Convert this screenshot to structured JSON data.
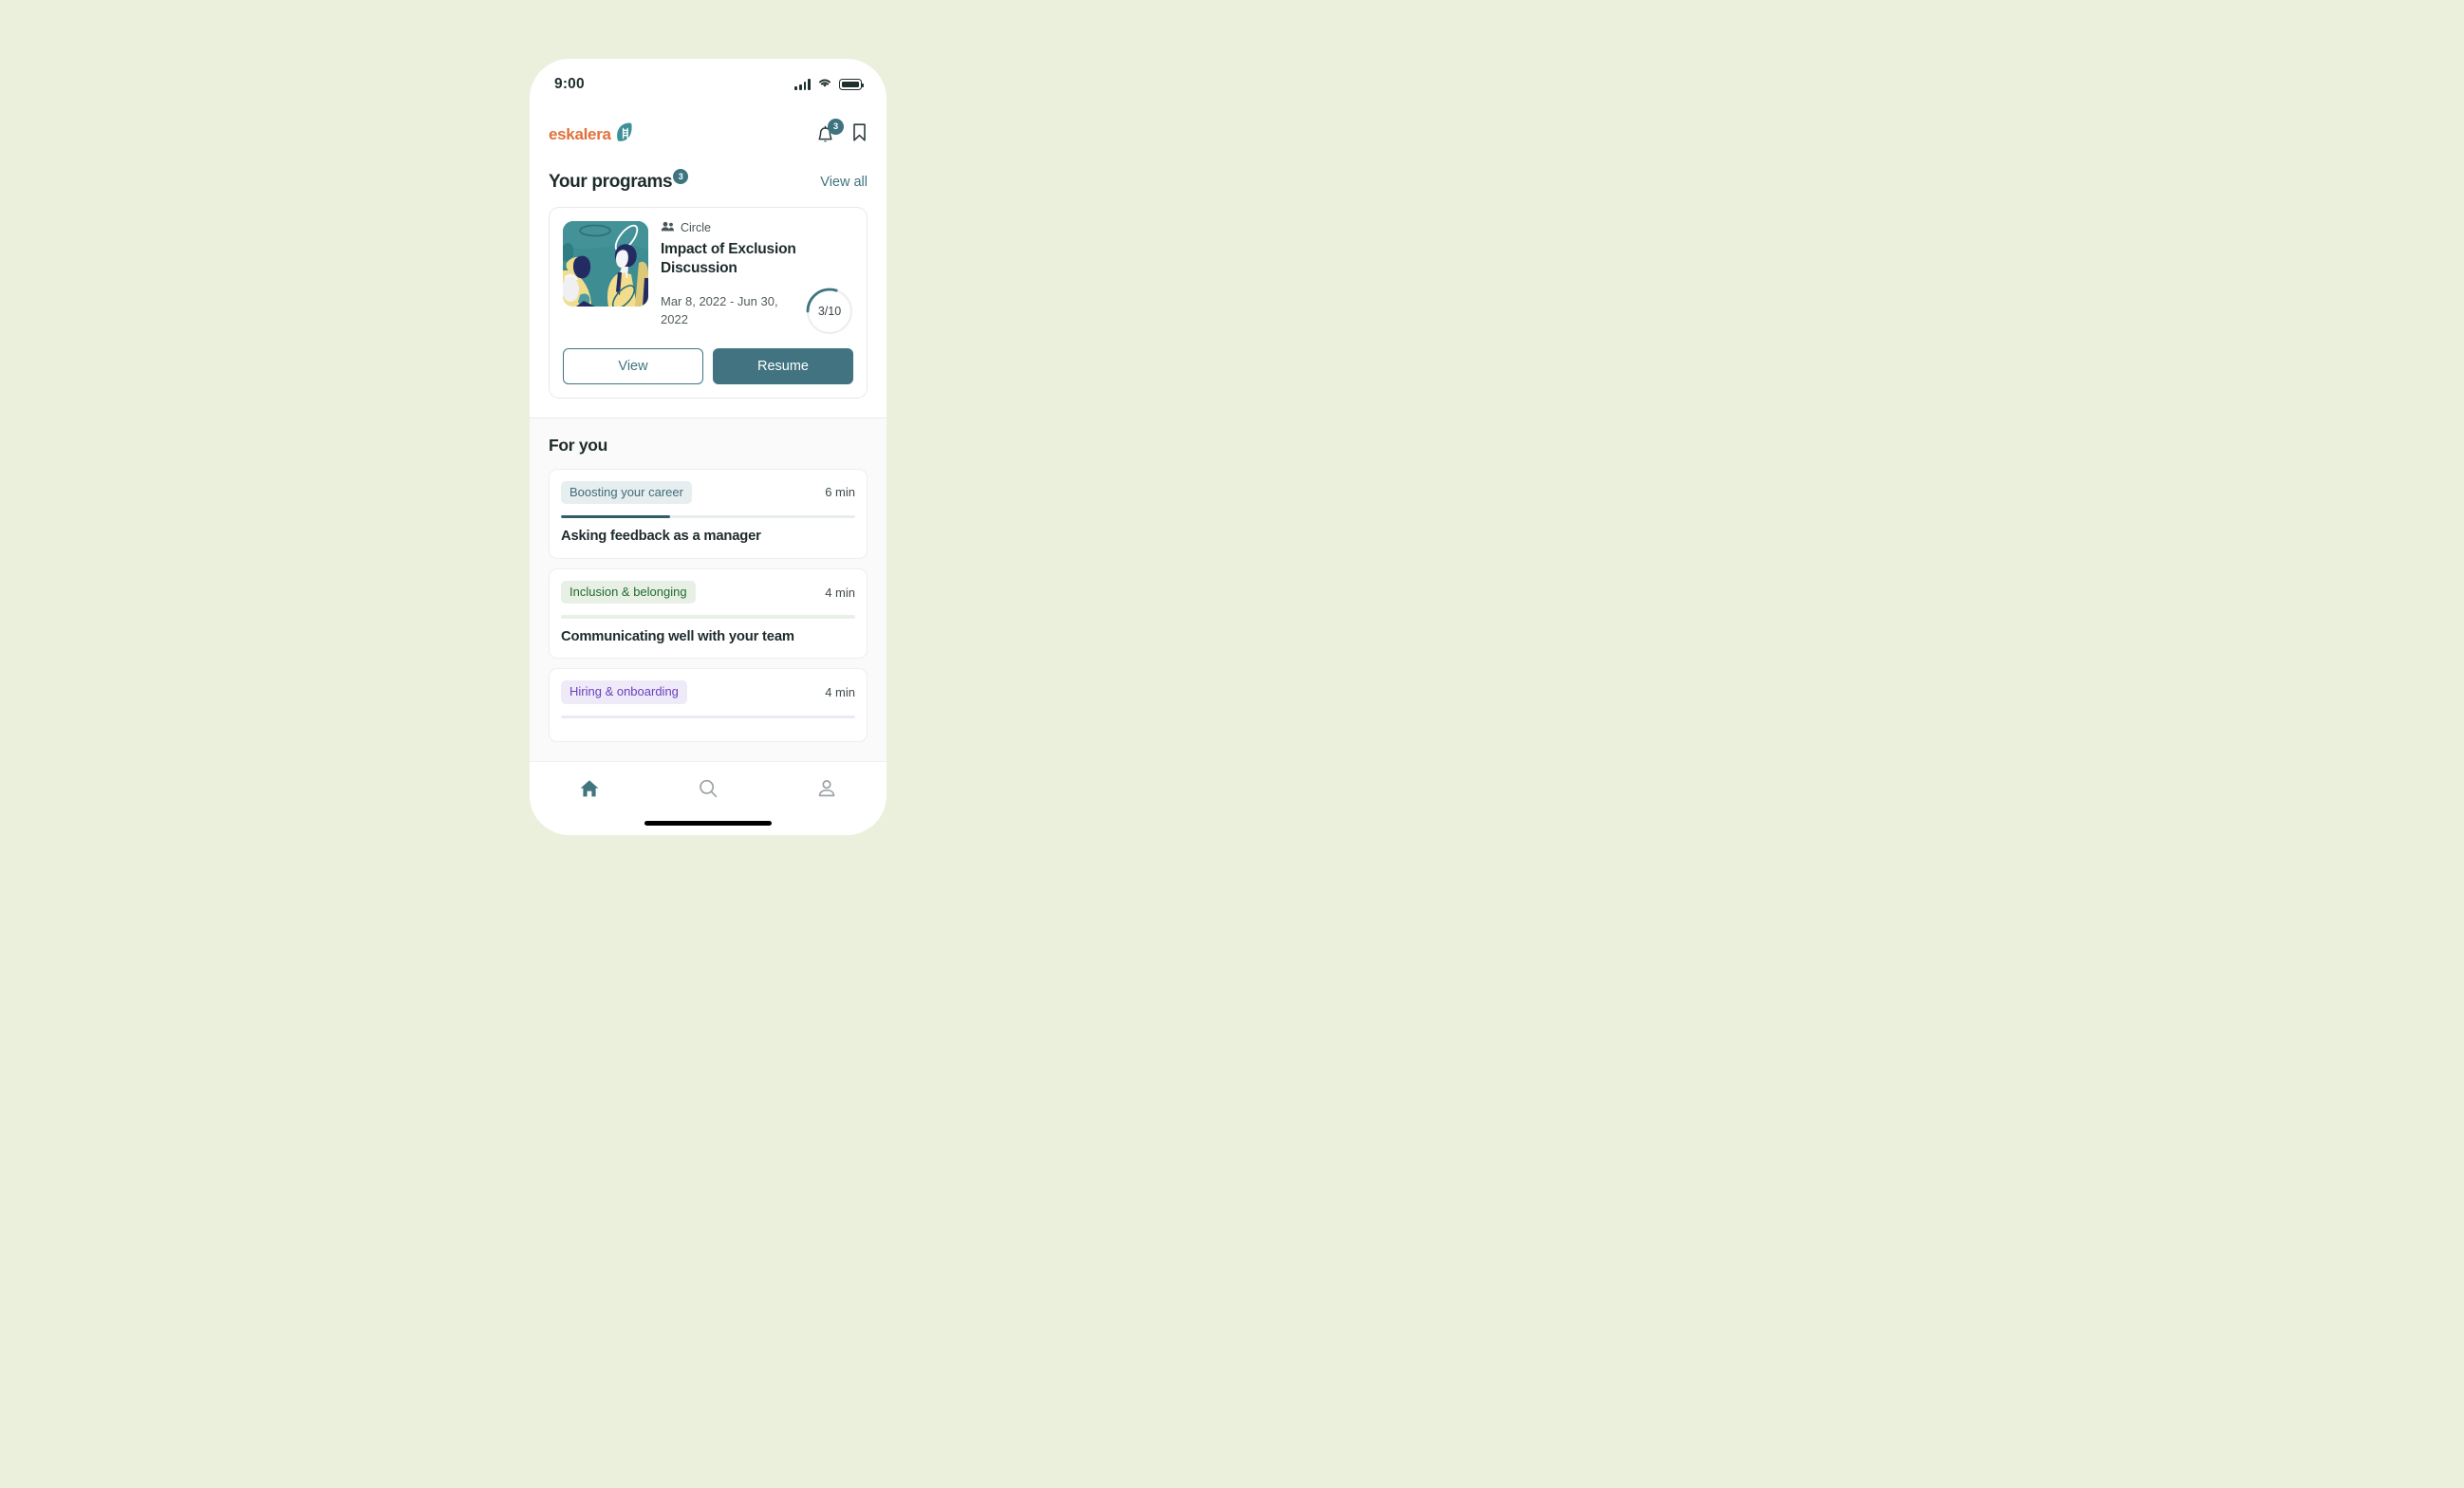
{
  "theme": {
    "page_background": "#eaf0dc",
    "accent_teal": "#3e7480",
    "accent_teal_dark": "#335d66",
    "brand_orange": "#e2703a",
    "text_dark": "#1e2b2b"
  },
  "status_bar": {
    "time": "9:00",
    "signal_icon": "cellular-signal-icon",
    "wifi_icon": "wifi-icon",
    "battery_icon": "battery-full-icon"
  },
  "app_bar": {
    "logo_text": "eskalera",
    "logo_mark": "leaf-ladder-logo-icon",
    "notifications": {
      "icon": "bell-icon",
      "badge_count": "3"
    },
    "bookmark": {
      "icon": "bookmark-icon"
    }
  },
  "programs": {
    "title": "Your programs",
    "count_badge": "3",
    "view_all_label": "View all",
    "card": {
      "thumbnail_icon": "program-illustration-thumbnail",
      "type_icon": "people-group-icon",
      "type_label": "Circle",
      "title": "Impact of Exclusion Discussion",
      "dates": "Mar 8, 2022 - Jun 30, 2022",
      "progress": {
        "label": "3/10",
        "completed": 3,
        "total": 10,
        "percent": 30
      },
      "buttons": {
        "view_label": "View",
        "resume_label": "Resume"
      }
    }
  },
  "for_you": {
    "title": "For you",
    "items": [
      {
        "tag": "Boosting your career",
        "tag_text_color": "#3e6b78",
        "tag_bg_color": "#e7eef0",
        "duration": "6 min",
        "title": "Asking feedback as a manager",
        "progress_percent": 37,
        "progress_fill_color": "#335d66",
        "progress_track_color": "#e9edee"
      },
      {
        "tag": "Inclusion & belonging",
        "tag_text_color": "#1f6b2e",
        "tag_bg_color": "#e8f0e6",
        "duration": "4 min",
        "title": "Communicating well with your team",
        "progress_percent": 0,
        "progress_fill_color": "#335d66",
        "progress_track_color": "#e9f0e7"
      },
      {
        "tag": "Hiring & onboarding",
        "tag_text_color": "#6b3fbf",
        "tag_bg_color": "#eeeaf8",
        "duration": "4 min",
        "title": "",
        "progress_percent": 0,
        "progress_fill_color": "#335d66",
        "progress_track_color": "#ece9f6"
      }
    ]
  },
  "tab_bar": {
    "items": [
      {
        "name": "home",
        "icon": "home-icon",
        "active": true
      },
      {
        "name": "search",
        "icon": "search-icon",
        "active": false
      },
      {
        "name": "profile",
        "icon": "person-icon",
        "active": false
      }
    ]
  }
}
